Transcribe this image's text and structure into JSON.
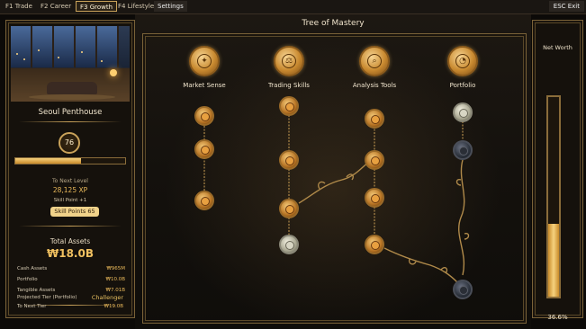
{
  "topbar": {
    "tabs": [
      {
        "key": "F1",
        "label": "Trade"
      },
      {
        "key": "F2",
        "label": "Career"
      },
      {
        "key": "F3",
        "label": "Growth"
      },
      {
        "key": "F4",
        "label": "Lifestyle"
      }
    ],
    "settings_label": "Settings",
    "esc_label": "ESC  Exit",
    "active_tab": "F3 Growth"
  },
  "left_panel": {
    "property_name": "Seoul Penthouse",
    "level": "76",
    "level_progress": 0.6,
    "next_level_label": "To Next Level",
    "xp_to_next": "28,125 XP",
    "skill_point_reward": "Skill Point +1",
    "skill_points_badge": "Skill Points 65",
    "total_assets_label": "Total Assets",
    "total_assets_value": "₩18.0B",
    "assets": [
      {
        "label": "Cash Assets",
        "value": "₩965M"
      },
      {
        "label": "Portfolio",
        "value": "₩10.0B"
      },
      {
        "label": "Tangible Assets",
        "value": "₩7.01B"
      }
    ],
    "projected_tier_label": "Projected Tier (Portfolio)",
    "projected_tier_value": "Challenger",
    "next_tier_label": "To Next Tier",
    "next_tier_value": "₩19.0B"
  },
  "tree": {
    "title": "Tree of Mastery",
    "categories": [
      {
        "label": "Market Sense",
        "icon": "brain-icon"
      },
      {
        "label": "Trading Skills",
        "icon": "scales-icon"
      },
      {
        "label": "Analysis Tools",
        "icon": "magnifier-chart-icon"
      },
      {
        "label": "Portfolio",
        "icon": "pie-chart-icon"
      }
    ]
  },
  "right_panel": {
    "net_worth_label": "Net Worth",
    "net_worth_percent": "36.6%",
    "net_worth_fraction": 0.366
  },
  "colors": {
    "accent_gold": "#c9a25a",
    "value_gold": "#e8b85a",
    "badge_bg": "#f0d28a"
  }
}
